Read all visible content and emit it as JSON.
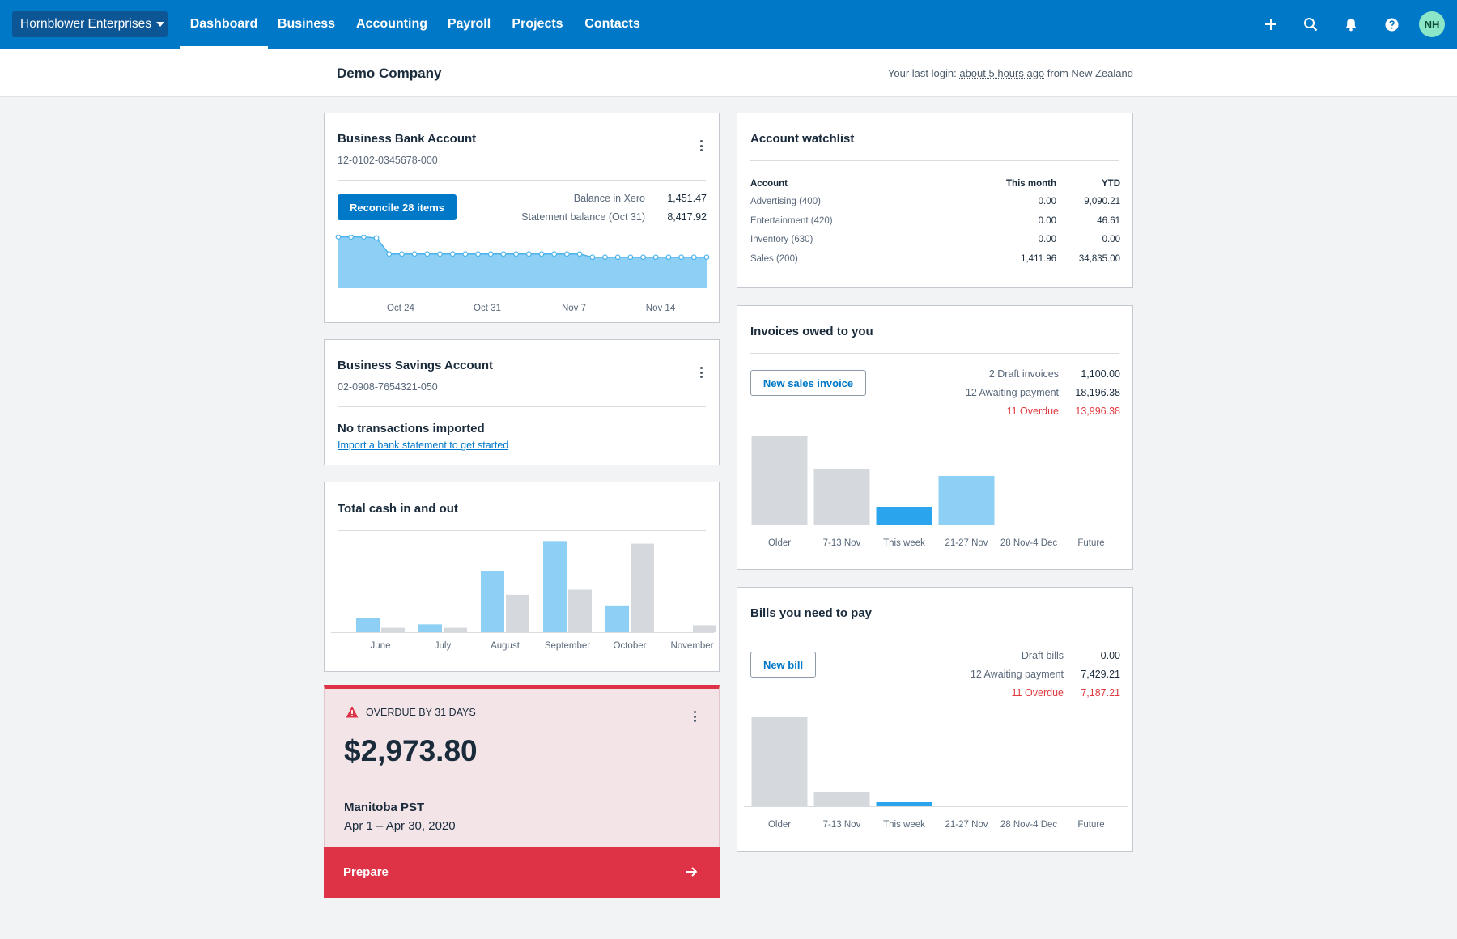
{
  "nav": {
    "org_name": "Hornblower Enterprises",
    "tabs": [
      "Dashboard",
      "Business",
      "Accounting",
      "Payroll",
      "Projects",
      "Contacts"
    ],
    "active_tab": "Dashboard",
    "avatar_initials": "NH",
    "icons": [
      "plus-icon",
      "search-icon",
      "bell-icon",
      "help-icon"
    ]
  },
  "subheader": {
    "company": "Demo Company",
    "login_prefix": "Your last login:",
    "login_ago": "about 5 hours ago",
    "login_suffix": "from New Zealand"
  },
  "bank_account": {
    "title": "Business Bank Account",
    "number": "12-0102-0345678-000",
    "reconcile_label": "Reconcile 28 items",
    "balance_xero_label": "Balance in Xero",
    "balance_xero": "1,451.47",
    "statement_label": "Statement balance (Oct 31)",
    "statement_balance": "8,417.92",
    "chart_data": {
      "type": "area",
      "x_ticks": [
        "Oct 24",
        "Oct 31",
        "Nov 7",
        "Nov 14"
      ],
      "values": [
        9600,
        9600,
        9600,
        9400,
        6400,
        6400,
        6400,
        6400,
        6400,
        6400,
        6400,
        6400,
        6400,
        6400,
        6400,
        6400,
        6400,
        6400,
        6400,
        6400,
        5800,
        5800,
        5800,
        5800,
        5800,
        5800,
        5800,
        5800,
        5800,
        5800
      ],
      "ylim": [
        0,
        10000
      ]
    }
  },
  "savings_account": {
    "title": "Business Savings Account",
    "number": "02-0908-7654321-050",
    "empty_title": "No transactions imported",
    "import_link": "Import a bank statement to get started"
  },
  "cash": {
    "title": "Total cash in and out",
    "chart_data": {
      "type": "bar",
      "categories": [
        "June",
        "July",
        "August",
        "September",
        "October",
        "November"
      ],
      "series": [
        {
          "values": [
            16,
            9,
            70,
            105,
            30,
            0
          ]
        },
        {
          "values": [
            5,
            5,
            43,
            49,
            102,
            8
          ]
        }
      ],
      "ylim": [
        0,
        110
      ],
      "colors": [
        "#8dcff5",
        "#d5d8dc"
      ]
    }
  },
  "overdue": {
    "badge": "OVERDUE BY 31 DAYS",
    "amount": "$2,973.80",
    "name": "Manitoba PST",
    "period": "Apr 1 – Apr 30, 2020",
    "action": "Prepare"
  },
  "watchlist": {
    "title": "Account watchlist",
    "headers": [
      "Account",
      "This month",
      "YTD"
    ],
    "rows": [
      {
        "account": "Advertising (400)",
        "month": "0.00",
        "ytd": "9,090.21"
      },
      {
        "account": "Entertainment (420)",
        "month": "0.00",
        "ytd": "46.61"
      },
      {
        "account": "Inventory (630)",
        "month": "0.00",
        "ytd": "0.00"
      },
      {
        "account": "Sales (200)",
        "month": "1,411.96",
        "ytd": "34,835.00"
      }
    ]
  },
  "invoices": {
    "title": "Invoices owed to you",
    "button": "New sales invoice",
    "stats": [
      {
        "label": "2 Draft invoices",
        "value": "1,100.00",
        "overdue": false
      },
      {
        "label": "12 Awaiting payment",
        "value": "18,196.38",
        "overdue": false
      },
      {
        "label": "11 Overdue",
        "value": "13,996.38",
        "overdue": true
      }
    ],
    "chart_data": {
      "type": "bar",
      "categories": [
        "Older",
        "7-13 Nov",
        "This week",
        "21-27 Nov",
        "28 Nov-4 Dec",
        "Future"
      ],
      "values": [
        110,
        68,
        22,
        60,
        0,
        0
      ],
      "colors": [
        "#d5d8dc",
        "#d5d8dc",
        "#2aa4ec",
        "#8dcff5",
        "#d5d8dc",
        "#d5d8dc"
      ],
      "ylim": [
        0,
        110
      ]
    }
  },
  "bills": {
    "title": "Bills you need to pay",
    "button": "New bill",
    "stats": [
      {
        "label": "Draft bills",
        "value": "0.00",
        "overdue": false
      },
      {
        "label": "12 Awaiting payment",
        "value": "7,429.21",
        "overdue": false
      },
      {
        "label": "11 Overdue",
        "value": "7,187.21",
        "overdue": true
      }
    ],
    "chart_data": {
      "type": "bar",
      "categories": [
        "Older",
        "7-13 Nov",
        "This week",
        "21-27 Nov",
        "28 Nov-4 Dec",
        "Future"
      ],
      "values": [
        110,
        17,
        5,
        0,
        0,
        0
      ],
      "colors": [
        "#d5d8dc",
        "#d5d8dc",
        "#2aa4ec",
        "#8dcff5",
        "#d5d8dc",
        "#d5d8dc"
      ],
      "ylim": [
        0,
        110
      ]
    }
  }
}
